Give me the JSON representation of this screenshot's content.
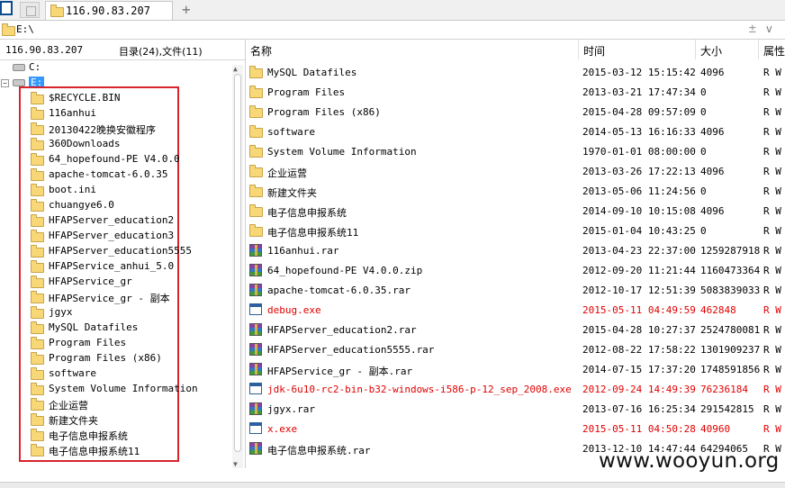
{
  "tab": {
    "title": "116.90.83.207",
    "new_tab": "+"
  },
  "address": {
    "path": "E:\\",
    "sort_icon": "±",
    "dropdown_icon": "v"
  },
  "left": {
    "header_ip": "116.90.83.207",
    "header_count": "目录(24),文件(11)",
    "drives": [
      {
        "label": "C:"
      },
      {
        "label": "E:"
      }
    ],
    "tree": [
      "$RECYCLE.BIN",
      "116anhui",
      "20130422晚换安徽程序",
      "360Downloads",
      "64_hopefound-PE V4.0.0",
      "apache-tomcat-6.0.35",
      "boot.ini",
      "chuangye6.0",
      "HFAPServer_education2",
      "HFAPServer_education3",
      "HFAPServer_education5555",
      "HFAPService_anhui_5.0",
      "HFAPService_gr",
      "HFAPService_gr - 副本",
      "jgyx",
      "MySQL Datafiles",
      "Program Files",
      "Program Files (x86)",
      "software",
      "System Volume Information",
      "企业运营",
      "新建文件夹",
      "电子信息申报系统",
      "电子信息申报系统11"
    ]
  },
  "columns": {
    "name": "名称",
    "time": "时间",
    "size": "大小",
    "attr": "属性"
  },
  "files": [
    {
      "name": "MySQL Datafiles",
      "time": "2015-03-12 15:15:42",
      "size": "4096",
      "attr": "R W",
      "icon": "folder",
      "red": false
    },
    {
      "name": "Program Files",
      "time": "2013-03-21 17:47:34",
      "size": "0",
      "attr": "R W",
      "icon": "folder",
      "red": false
    },
    {
      "name": "Program Files (x86)",
      "time": "2015-04-28 09:57:09",
      "size": "0",
      "attr": "R W",
      "icon": "folder",
      "red": false
    },
    {
      "name": "software",
      "time": "2014-05-13 16:16:33",
      "size": "4096",
      "attr": "R W",
      "icon": "folder",
      "red": false
    },
    {
      "name": "System Volume Information",
      "time": "1970-01-01 08:00:00",
      "size": "0",
      "attr": "R W",
      "icon": "folder",
      "red": false
    },
    {
      "name": "企业运营",
      "time": "2013-03-26 17:22:13",
      "size": "4096",
      "attr": "R W",
      "icon": "folder",
      "red": false
    },
    {
      "name": "新建文件夹",
      "time": "2013-05-06 11:24:56",
      "size": "0",
      "attr": "R W",
      "icon": "folder",
      "red": false
    },
    {
      "name": "电子信息申报系统",
      "time": "2014-09-10 10:15:08",
      "size": "4096",
      "attr": "R W",
      "icon": "folder",
      "red": false
    },
    {
      "name": "电子信息申报系统11",
      "time": "2015-01-04 10:43:25",
      "size": "0",
      "attr": "R W",
      "icon": "folder",
      "red": false
    },
    {
      "name": "116anhui.rar",
      "time": "2013-04-23 22:37:00",
      "size": "1259287918",
      "attr": "R W",
      "icon": "rar",
      "red": false
    },
    {
      "name": "64_hopefound-PE V4.0.0.zip",
      "time": "2012-09-20 11:21:44",
      "size": "1160473364",
      "attr": "R W",
      "icon": "rar",
      "red": false
    },
    {
      "name": "apache-tomcat-6.0.35.rar",
      "time": "2012-10-17 12:51:39",
      "size": "5083839033",
      "attr": "R W",
      "icon": "rar",
      "red": false
    },
    {
      "name": "debug.exe",
      "time": "2015-05-11 04:49:59",
      "size": "462848",
      "attr": "R W",
      "icon": "exe",
      "red": true
    },
    {
      "name": "HFAPServer_education2.rar",
      "time": "2015-04-28 10:27:37",
      "size": "2524780081",
      "attr": "R W",
      "icon": "rar",
      "red": false
    },
    {
      "name": "HFAPServer_education5555.rar",
      "time": "2012-08-22 17:58:22",
      "size": "1301909237",
      "attr": "R W",
      "icon": "rar",
      "red": false
    },
    {
      "name": "HFAPService_gr - 副本.rar",
      "time": "2014-07-15 17:37:20",
      "size": "1748591856",
      "attr": "R W",
      "icon": "rar",
      "red": false
    },
    {
      "name": "jdk-6u10-rc2-bin-b32-windows-i586-p-12_sep_2008.exe",
      "time": "2012-09-24 14:49:39",
      "size": "76236184",
      "attr": "R W",
      "icon": "exe",
      "red": true
    },
    {
      "name": "jgyx.rar",
      "time": "2013-07-16 16:25:34",
      "size": "291542815",
      "attr": "R W",
      "icon": "rar",
      "red": false
    },
    {
      "name": "x.exe",
      "time": "2015-05-11 04:50:28",
      "size": "40960",
      "attr": "R W",
      "icon": "exe",
      "red": true
    },
    {
      "name": "电子信息申报系统.rar",
      "time": "2013-12-10 14:47:44",
      "size": "64294065",
      "attr": "R W",
      "icon": "rar",
      "red": false
    }
  ],
  "watermark": "www.wooyun.org"
}
